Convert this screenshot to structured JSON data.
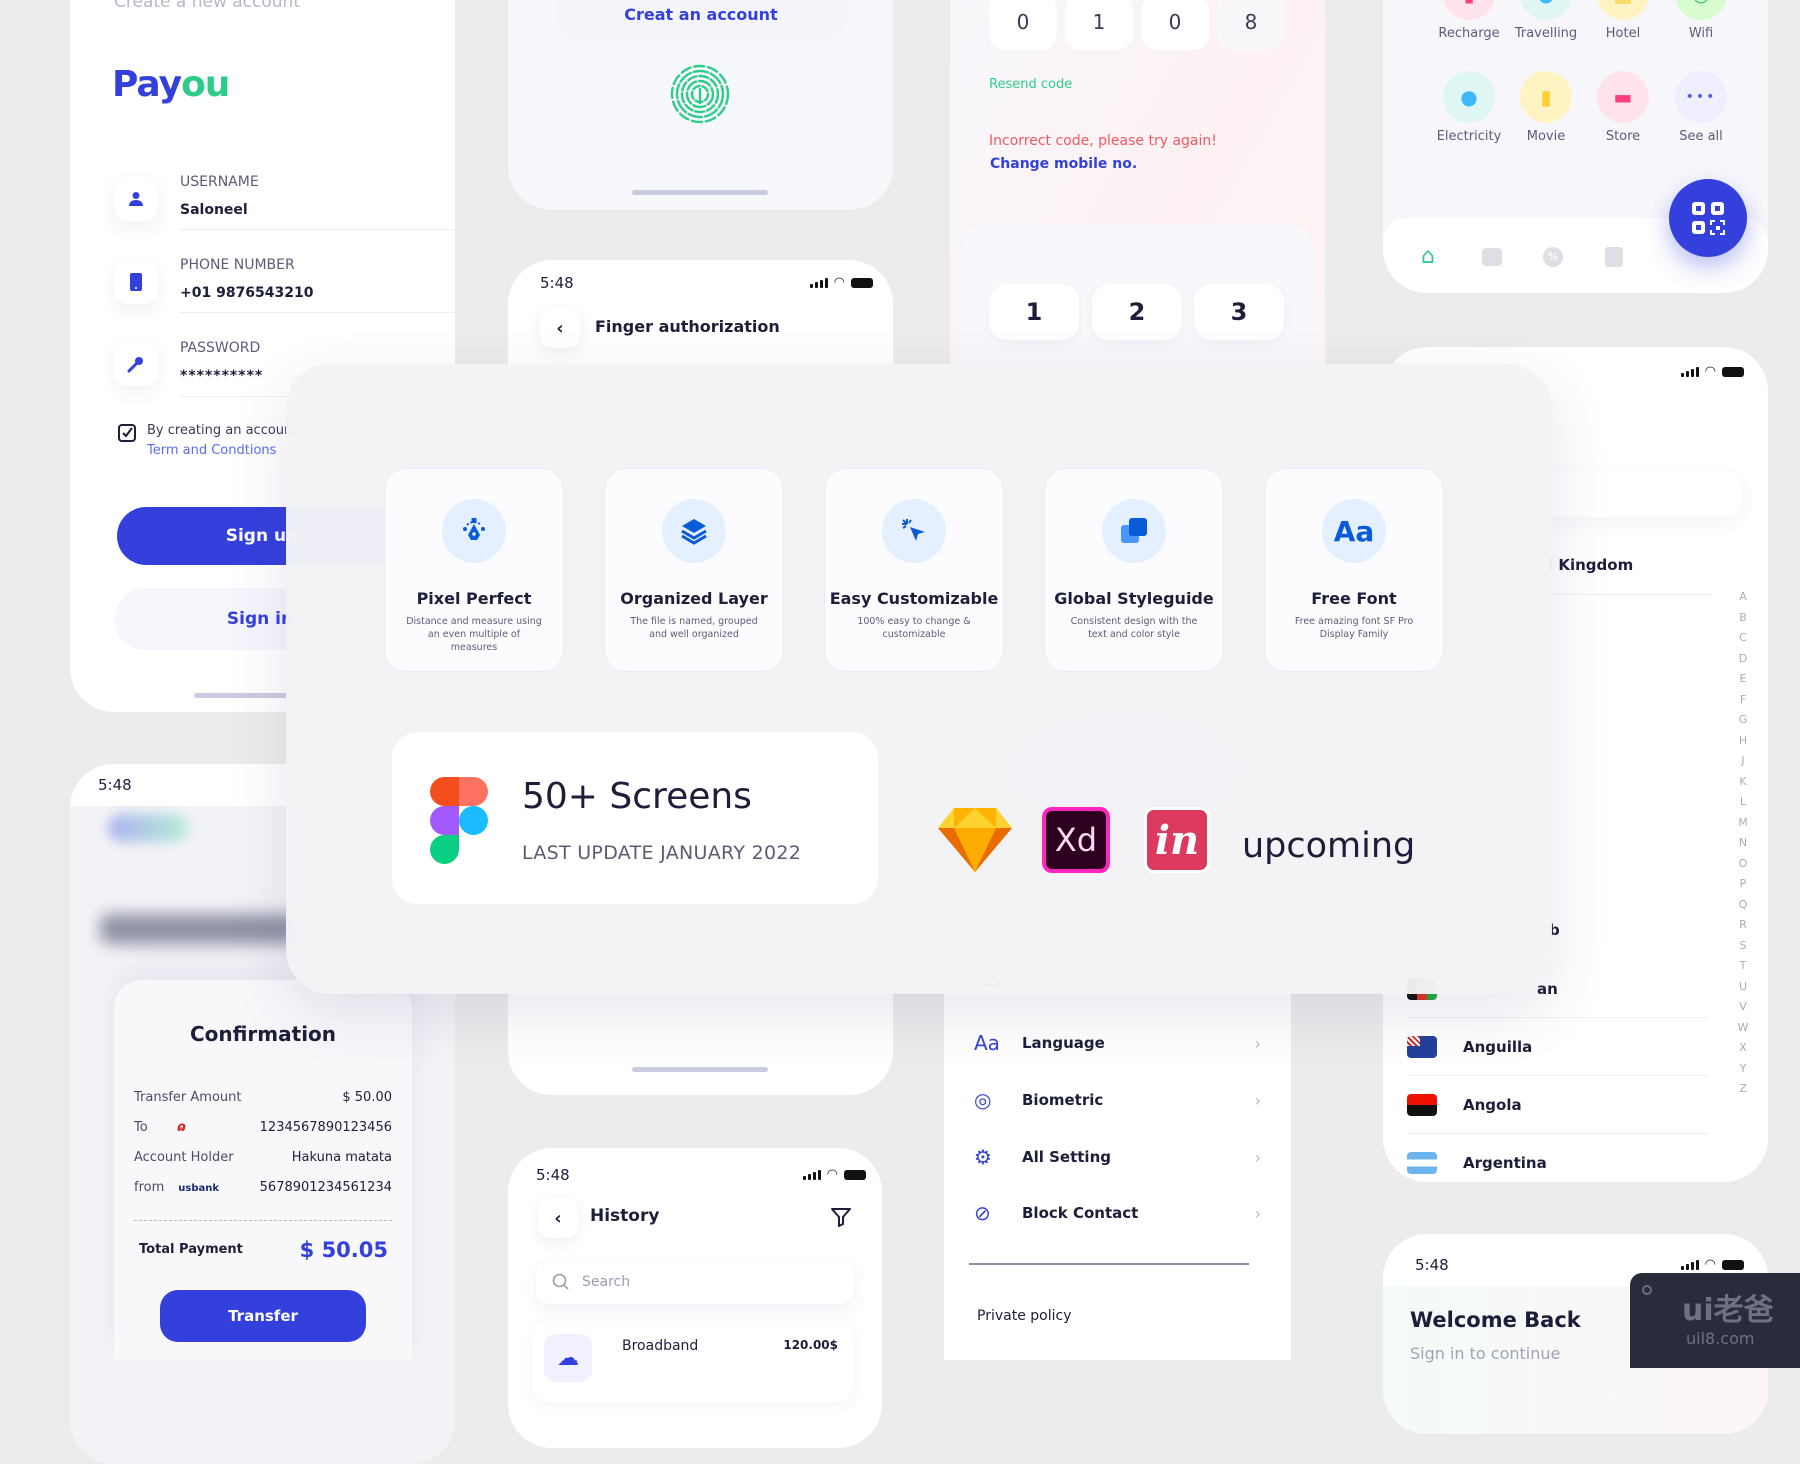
{
  "signup": {
    "subtitle": "Create a new account",
    "logo_pay": "Pay",
    "logo_ou": "ou",
    "fields": [
      {
        "label": "USERNAME",
        "value": "Saloneel",
        "icon": "user-icon"
      },
      {
        "label": "PHONE NUMBER",
        "value": "+01 9876543210",
        "icon": "phone-icon"
      },
      {
        "label": "PASSWORD",
        "value": "**********",
        "icon": "key-icon"
      }
    ],
    "terms_text": "By creating an account",
    "terms_link": "Term and Condtions",
    "signup_button": "Sign up",
    "signin_button": "Sign in"
  },
  "login_card": {
    "create_account": "Creat an account"
  },
  "finger_auth": {
    "time": "5:48",
    "title": "Finger authorization"
  },
  "otp": {
    "digits": [
      "0",
      "1",
      "0",
      "8"
    ],
    "resend": "Resend code",
    "error": "Incorrect code, please try again!",
    "change_mobile": "Change mobile no.",
    "keys": [
      "1",
      "2",
      "3"
    ]
  },
  "services": {
    "row1": [
      {
        "label": "Recharge",
        "color": "#ffe3ec",
        "glyph": "▮",
        "glyph_color": "#ff3d7f"
      },
      {
        "label": "Travelling",
        "color": "#dff7f4",
        "glyph": "◒",
        "glyph_color": "#3fb7ff"
      },
      {
        "label": "Hotel",
        "color": "#fff3c4",
        "glyph": "▦",
        "glyph_color": "#ffcf2e"
      },
      {
        "label": "Wifi",
        "color": "#d8fbcf",
        "glyph": "◔",
        "glyph_color": "#22c55e"
      }
    ],
    "row2": [
      {
        "label": "Electricity",
        "color": "#dff7f4",
        "glyph": "●",
        "glyph_color": "#3fb7ff"
      },
      {
        "label": "Movie",
        "color": "#fff3c4",
        "glyph": "▮",
        "glyph_color": "#ffcf2e"
      },
      {
        "label": "Store",
        "color": "#ffe3ec",
        "glyph": "▬",
        "glyph_color": "#ff3d7f"
      },
      {
        "label": "See all",
        "color": "#efeefe",
        "glyph": "•••",
        "glyph_color": "#5b5fe8"
      }
    ]
  },
  "showcase": {
    "features": [
      {
        "title": "Pixel Perfect",
        "desc": "Distance and measure using an even multiple of measures",
        "icon": "pen-tool-icon"
      },
      {
        "title": "Organized Layer",
        "desc": "The file is named, grouped and well organized",
        "icon": "layers-icon"
      },
      {
        "title": "Easy Customizable",
        "desc": "100% easy to change & customizable",
        "icon": "cursor-click-icon"
      },
      {
        "title": "Global Styleguide",
        "desc": "Consistent design with the text and color style",
        "icon": "styleguide-icon"
      },
      {
        "title": "Free Font",
        "desc": "Free amazing font SF Pro Display Family",
        "icon": "font-icon"
      }
    ],
    "screens_title": "50+ Screens",
    "last_update": "LAST UPDATE JANUARY 2022",
    "xd_label": "Xd",
    "invision_label": "in",
    "upcoming": "upcoming",
    "font_glyph": "Aa"
  },
  "dashboard": {
    "time": "5:48"
  },
  "confirmation": {
    "title": "Confirmation",
    "rows": [
      {
        "label": "Transfer Amount",
        "value": "$ 50.00"
      },
      {
        "label": "To",
        "value": "1234567890123456"
      },
      {
        "label": "Account Holder",
        "value": "Hakuna matata"
      },
      {
        "label": "from",
        "value": "5678901234561234"
      }
    ],
    "bank_logo": "usbank",
    "total_label": "Total Payment",
    "total_value": "$ 50.05",
    "transfer_button": "Transfer"
  },
  "history": {
    "time": "5:48",
    "title": "History",
    "search_placeholder": "Search",
    "items": [
      {
        "name": "Broadband",
        "amount": "120.00$"
      }
    ]
  },
  "settings": {
    "items": [
      {
        "label": "Language",
        "icon": "font-icon"
      },
      {
        "label": "Biometric",
        "icon": "fingerprint-icon"
      },
      {
        "label": "All Setting",
        "icon": "gear-icon"
      },
      {
        "label": "Block Contact",
        "icon": "block-icon"
      }
    ],
    "private_policy": "Private policy"
  },
  "countries": {
    "selected": "United Kingdom",
    "partial_selected": "l Kingdom",
    "partial_b": "b",
    "partial_af": "an",
    "list": [
      "Anguilla",
      "Angola",
      "Argentina"
    ],
    "alphabet": [
      "A",
      "B",
      "C",
      "D",
      "E",
      "F",
      "G",
      "H",
      "J",
      "K",
      "L",
      "M",
      "N",
      "O",
      "P",
      "Q",
      "R",
      "S",
      "T",
      "U",
      "V",
      "W",
      "X",
      "Y",
      "Z"
    ]
  },
  "welcome": {
    "time": "5:48",
    "title": "Welcome Back",
    "subtitle": "Sign in to continue"
  },
  "watermark": {
    "logo": "ui老爸",
    "url": "uil8.com"
  },
  "colors": {
    "primary": "#3340dc",
    "green": "#2ecc8a",
    "error": "#f0595f",
    "dark": "#1d1e3a"
  }
}
